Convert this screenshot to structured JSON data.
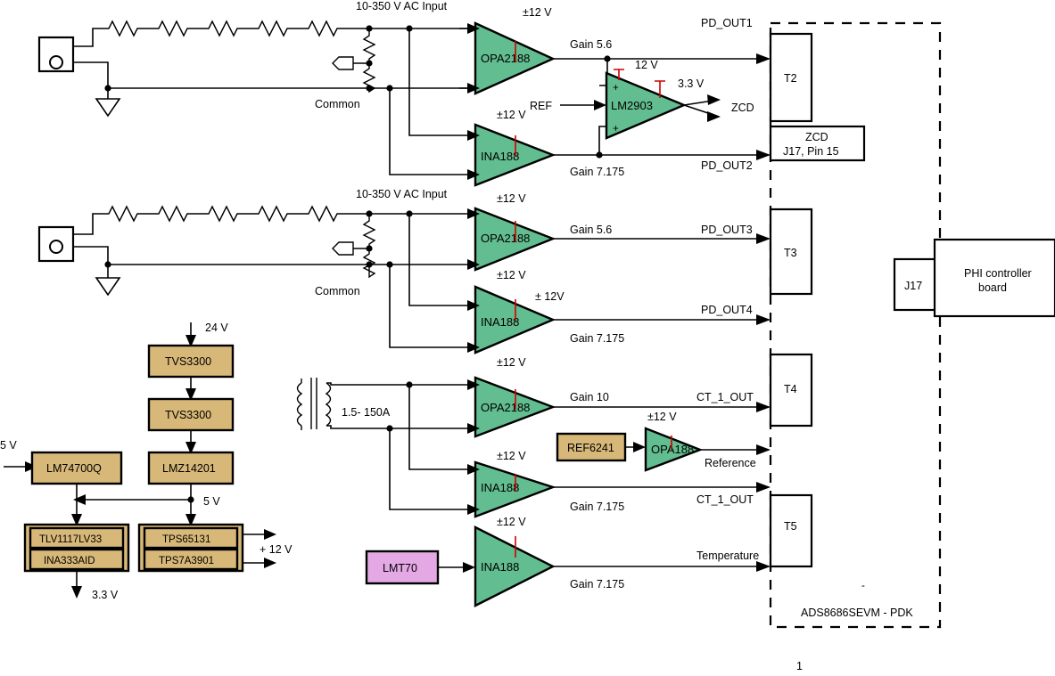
{
  "diagram": {
    "title": "ADS8686SEVM - PDK",
    "page_number": "1",
    "enclosure_label": "ADS8686SEVM - PDK"
  },
  "inputs": {
    "ac_input_1": "10-350 V AC Input",
    "ac_input_2": "10-350 V AC Input",
    "common_1": "Common",
    "common_2": "Common",
    "ct_range": "1.5- 150A"
  },
  "amplifiers": [
    {
      "name": "OPA2188",
      "rail": "±12 V",
      "gain": "Gain 5.6",
      "out": "PD_OUT1"
    },
    {
      "name": "INA188",
      "rail": "±12 V",
      "gain": "Gain 7.175",
      "out": "PD_OUT2"
    },
    {
      "name": "OPA2188",
      "rail": "±12 V",
      "gain": "Gain 5.6",
      "out": "PD_OUT3"
    },
    {
      "name": "INA188",
      "rail": "± 12V",
      "gain": "Gain 7.175",
      "out": "PD_OUT4"
    },
    {
      "name": "OPA2188",
      "rail": "±12 V",
      "gain": "Gain 10",
      "out": "CT_1_OUT"
    },
    {
      "name": "INA188",
      "rail": "±12 V",
      "gain": "Gain 7.175",
      "out": "CT_1_OUT"
    },
    {
      "name": "INA188",
      "rail": "±12 V",
      "gain": "Gain 7.175",
      "out": "Temperature"
    }
  ],
  "comparator": {
    "name": "LM2903",
    "rail_top": "12 V",
    "rail_second": "3.3 V",
    "ref_label": "REF",
    "out": "ZCD",
    "plus_top": "+",
    "plus_bottom": "+"
  },
  "reference": {
    "source": "REF6241",
    "buffer": "OPA188",
    "buffer_rail": "±12 V",
    "out": "Reference"
  },
  "temperature_sensor": {
    "name": "LMT70"
  },
  "power": {
    "input_24v": "24  V",
    "input_5v": "5 V",
    "tvs_1": "TVS3300",
    "tvs_2": "TVS3300",
    "buck": "LMZ14201",
    "ideal_diode": "LM74700Q",
    "mid_rail": "5 V",
    "ldo_1": "TLV1117LV33",
    "ldo_2": "INA333AID",
    "conv_1": "TPS65131",
    "conv_2": "TPS7A3901",
    "out_12v": "+ 12 V",
    "out_33v": "3.3 V"
  },
  "terminals": [
    {
      "label": "T2"
    },
    {
      "label": "T3"
    },
    {
      "label": "T4"
    },
    {
      "label": "T5"
    }
  ],
  "zcd_connector": {
    "line1": "ZCD",
    "line2": "J17, Pin 15"
  },
  "controller": {
    "connector": "J17",
    "name_line1": "PHI controller",
    "name_line2": "board"
  },
  "colors": {
    "amplifier_fill": "#62bd90",
    "power_block_fill": "#d8b878",
    "sensor_fill": "#e4a9e4",
    "supply_rail": "#cc0000"
  }
}
